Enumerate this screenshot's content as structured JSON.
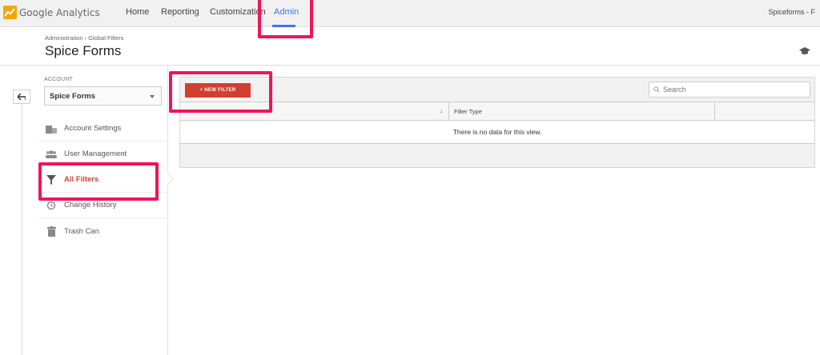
{
  "topbar": {
    "brand": "Google Analytics",
    "nav": [
      "Home",
      "Reporting",
      "Customization",
      "Admin"
    ],
    "active_tab": "Admin",
    "account_name": "Spiceforms - F"
  },
  "header": {
    "breadcrumb": "Administration › Global Filters",
    "title": "Spice Forms"
  },
  "sidebar": {
    "account_label": "ACCOUNT",
    "account_selected": "Spice Forms",
    "items": [
      {
        "label": "Account Settings",
        "icon": "building-icon"
      },
      {
        "label": "User Management",
        "icon": "users-icon"
      },
      {
        "label": "All Filters",
        "icon": "filter-icon",
        "active": true
      },
      {
        "label": "Change History",
        "icon": "history-icon"
      },
      {
        "label": "Trash Can",
        "icon": "trash-icon"
      }
    ]
  },
  "filters": {
    "new_button": "+ NEW FILTER",
    "search_placeholder": "Search",
    "columns": [
      "",
      "Filter Type",
      ""
    ],
    "sort_indicator": "↓",
    "empty_message": "There is no data for this view."
  },
  "colors": {
    "accent": "#3b78e7",
    "primary_button": "#d23f31",
    "highlight": "#f0145a"
  }
}
